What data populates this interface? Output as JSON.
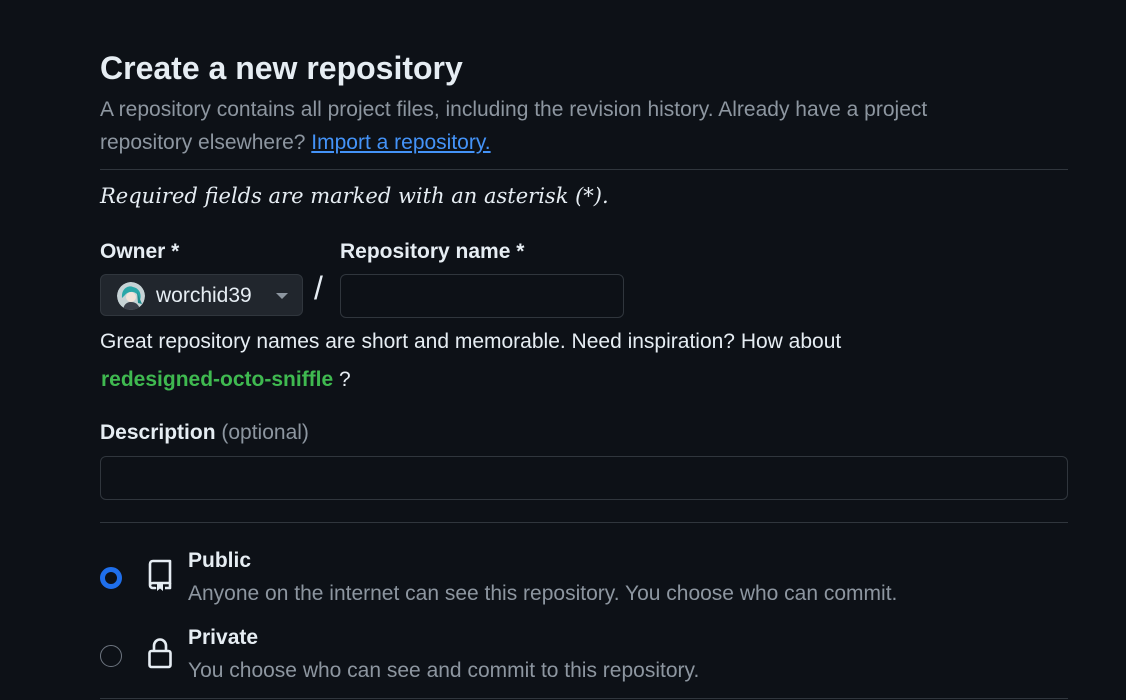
{
  "header": {
    "title": "Create a new repository",
    "subtitle_text": "A repository contains all project files, including the revision history. Already have a project repository elsewhere?",
    "import_link": "Import a repository."
  },
  "form": {
    "required_note": "Required fields are marked with an asterisk (*).",
    "owner_label": "Owner *",
    "owner_value": "worchid39",
    "separator": "/",
    "repo_name_label": "Repository name *",
    "repo_name_value": "",
    "name_hint": "Great repository names are short and memorable. Need inspiration? How about",
    "suggested_name": "redesigned-octo-sniffle",
    "suggestion_suffix": "?",
    "description_label": "Description",
    "description_optional": "(optional)",
    "description_value": ""
  },
  "visibility": {
    "options": [
      {
        "title": "Public",
        "description": "Anyone on the internet can see this repository. You choose who can commit.",
        "icon": "repo-icon",
        "selected": true
      },
      {
        "title": "Private",
        "description": "You choose who can see and commit to this repository.",
        "icon": "lock-icon",
        "selected": false
      }
    ]
  },
  "colors": {
    "background": "#0d1117",
    "link": "#4493f8",
    "suggestion": "#3fb950",
    "radio_accent": "#1f6feb",
    "border": "#30363d"
  }
}
